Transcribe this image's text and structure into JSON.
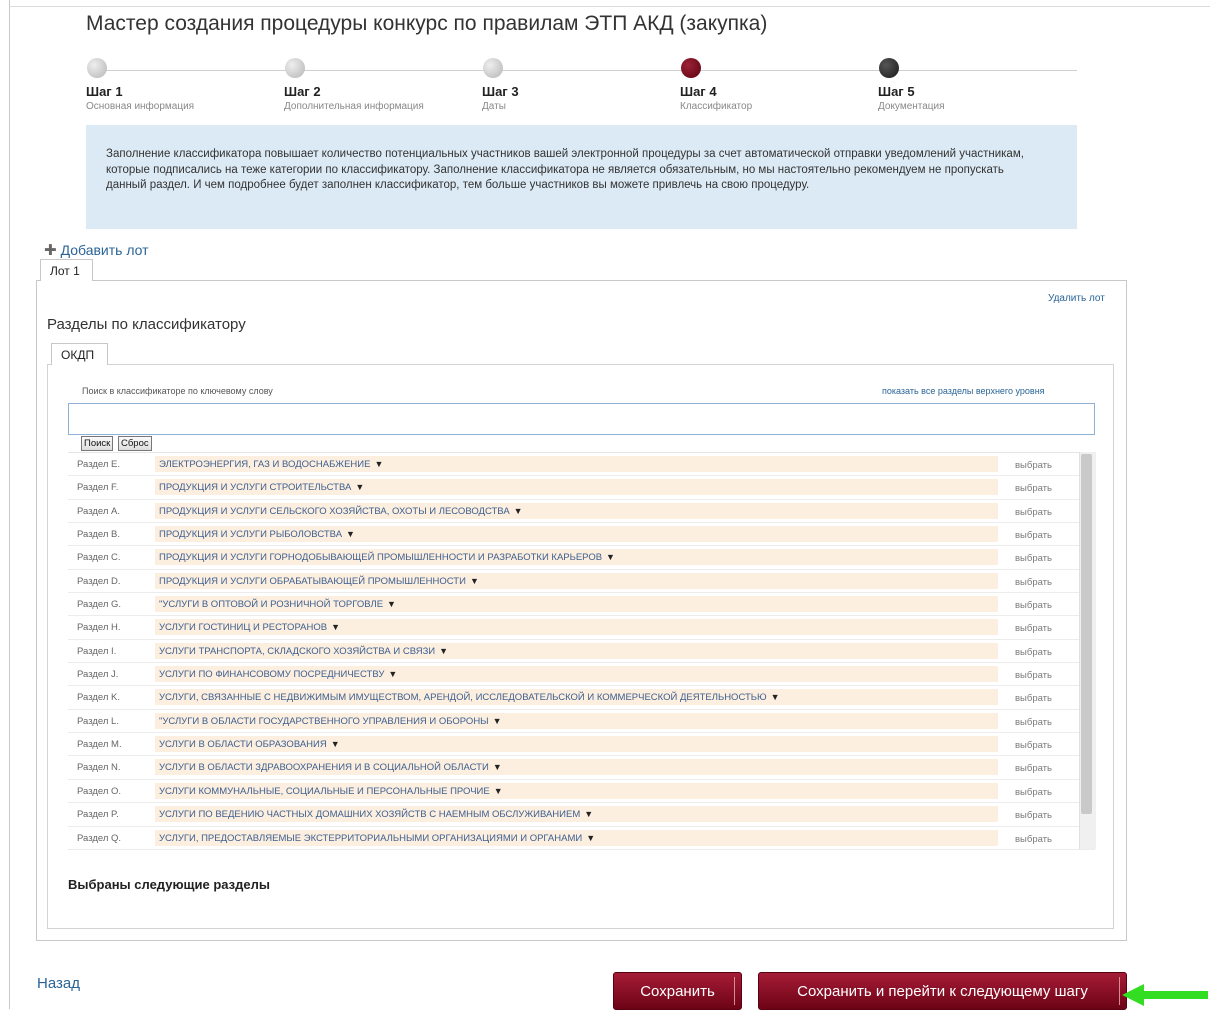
{
  "title": "Мастер создания процедуры конкурс по правилам ЭТП АКД (закупка)",
  "steps": [
    {
      "title": "Шаг 1",
      "subtitle": "Основная информация",
      "state": "done"
    },
    {
      "title": "Шаг 2",
      "subtitle": "Дополнительная информация",
      "state": "done"
    },
    {
      "title": "Шаг 3",
      "subtitle": "Даты",
      "state": "done"
    },
    {
      "title": "Шаг 4",
      "subtitle": "Классификатор",
      "state": "current"
    },
    {
      "title": "Шаг 5",
      "subtitle": "Документация",
      "state": "todo"
    }
  ],
  "info_text": "Заполнение классификатора повышает количество потенциальных участников вашей электронной процедуры за счет автоматической отправки уведомлений участникам, которые подписались на теже категории по классификатору. Заполнение классификатора не является обязательным, но мы настоятельно рекомендуем не пропускать данный раздел. И чем подробнее будет заполнен классификатор, тем больше участников вы можете привлечь на свою процедуру.",
  "add_lot": "Добавить лот",
  "lot_tab": "Лот 1",
  "delete_lot": "Удалить лот",
  "sections_title": "Разделы по классификатору",
  "classifier_tab": "ОКДП",
  "search": {
    "label": "Поиск в классификаторе по ключевому слову",
    "show_top": "показать все разделы верхнего уровня",
    "value": "",
    "search_btn": "Поиск",
    "reset_btn": "Сброс"
  },
  "pick_label": "выбрать",
  "sections": [
    {
      "code": "Раздел E.",
      "name": "ЭЛЕКТРОЭНЕРГИЯ, ГАЗ И ВОДОСНАБЖЕНИЕ"
    },
    {
      "code": "Раздел F.",
      "name": "ПРОДУКЦИЯ И УСЛУГИ СТРОИТЕЛЬСТВА"
    },
    {
      "code": "Раздел A.",
      "name": "ПРОДУКЦИЯ И УСЛУГИ СЕЛЬСКОГО ХОЗЯЙСТВА, ОХОТЫ И ЛЕСОВОДСТВА"
    },
    {
      "code": "Раздел B.",
      "name": "ПРОДУКЦИЯ И УСЛУГИ РЫБОЛОВСТВА"
    },
    {
      "code": "Раздел C.",
      "name": "ПРОДУКЦИЯ И УСЛУГИ ГОРНОДОБЫВАЮЩЕЙ ПРОМЫШЛЕННОСТИ И РАЗРАБОТКИ КАРЬЕРОВ"
    },
    {
      "code": "Раздел D.",
      "name": "ПРОДУКЦИЯ И УСЛУГИ ОБРАБАТЫВАЮЩЕЙ ПРОМЫШЛЕННОСТИ"
    },
    {
      "code": "Раздел G.",
      "name": "\"УСЛУГИ В ОПТОВОЙ И РОЗНИЧНОЙ ТОРГОВЛЕ"
    },
    {
      "code": "Раздел H.",
      "name": "УСЛУГИ ГОСТИНИЦ И РЕСТОРАНОВ"
    },
    {
      "code": "Раздел I.",
      "name": "УСЛУГИ ТРАНСПОРТА, СКЛАДСКОГО ХОЗЯЙСТВА И СВЯЗИ"
    },
    {
      "code": "Раздел J.",
      "name": "УСЛУГИ ПО ФИНАНСОВОМУ ПОСРЕДНИЧЕСТВУ"
    },
    {
      "code": "Раздел K.",
      "name": "УСЛУГИ, СВЯЗАННЫЕ С НЕДВИЖИМЫМ ИМУЩЕСТВОМ, АРЕНДОЙ, ИССЛЕДОВАТЕЛЬСКОЙ И КОММЕРЧЕСКОЙ ДЕЯТЕЛЬНОСТЬЮ"
    },
    {
      "code": "Раздел L.",
      "name": "\"УСЛУГИ В ОБЛАСТИ ГОСУДАРСТВЕННОГО УПРАВЛЕНИЯ И ОБОРОНЫ"
    },
    {
      "code": "Раздел M.",
      "name": "УСЛУГИ В ОБЛАСТИ ОБРАЗОВАНИЯ"
    },
    {
      "code": "Раздел N.",
      "name": "УСЛУГИ В ОБЛАСТИ ЗДРАВООХРАНЕНИЯ И В СОЦИАЛЬНОЙ ОБЛАСТИ"
    },
    {
      "code": "Раздел O.",
      "name": "УСЛУГИ КОММУНАЛЬНЫЕ, СОЦИАЛЬНЫЕ И ПЕРСОНАЛЬНЫЕ ПРОЧИЕ"
    },
    {
      "code": "Раздел P.",
      "name": "УСЛУГИ ПО ВЕДЕНИЮ ЧАСТНЫХ ДОМАШНИХ ХОЗЯЙСТВ С НАЕМНЫМ ОБСЛУЖИВАНИЕМ"
    },
    {
      "code": "Раздел Q.",
      "name": "УСЛУГИ, ПРЕДОСТАВЛЯЕМЫЕ ЭКСТЕРРИТОРИАЛЬНЫМИ ОРГАНИЗАЦИЯМИ И ОРГАНАМИ"
    }
  ],
  "selected_title": "Выбраны следующие разделы",
  "back": "Назад",
  "save": "Сохранить",
  "save_next": "Сохранить и перейти к следующему шагу",
  "colors": {
    "accent_red": "#7d0a1f",
    "link_blue": "#2a6496",
    "info_bg": "#dceaf5",
    "row_bg": "#fcefe0",
    "arrow_green": "#33dd22"
  }
}
